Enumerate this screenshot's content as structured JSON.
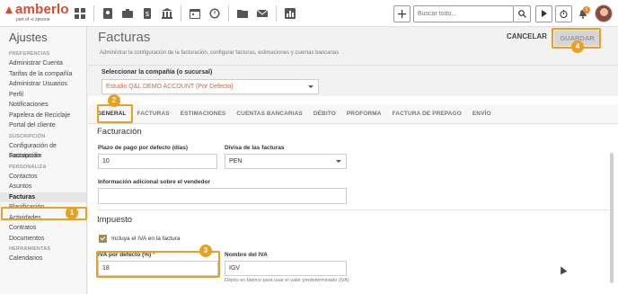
{
  "brand": {
    "name": "amberlo",
    "tagline": "part of ⊲ zpnone",
    "color": "#d84a2e"
  },
  "topbar": {
    "icons": [
      "dashboard-icon",
      "contacts-icon",
      "briefcase-icon",
      "invoice-icon",
      "bank-icon",
      "calendar-icon",
      "history-icon",
      "folder-icon",
      "mail-icon",
      "reports-icon"
    ],
    "search_placeholder": "Buscar todo...",
    "notification_count": "1"
  },
  "sidebar": {
    "title": "Ajustes",
    "sections": [
      {
        "heading": "PREFERENCIAS",
        "items": [
          "Administrar Cuenta",
          "Tarifas de la compañía",
          "Administrar Usuarios",
          "Perfil",
          "Notificaciones",
          "Papelera de Reciclaje",
          "Portal del cliente"
        ]
      },
      {
        "heading": "SUSCRIPCIÓN",
        "items": [
          "Configuración de suscripción",
          "Facturación"
        ]
      },
      {
        "heading": "PERSONALIZA",
        "items": [
          "Contactos",
          "Asuntos",
          "Facturas",
          "Planificación",
          "Actividades",
          "Contratos",
          "Documentos"
        ]
      },
      {
        "heading": "HERRAMIENTAS",
        "items": [
          "Calendarios"
        ]
      }
    ],
    "active_item": "Facturas"
  },
  "header": {
    "title": "Facturas",
    "description": "Administrar la configuración de la facturación, configurar facturas, estimaciones y cuentas bancarias",
    "cancel_label": "CANCELAR",
    "save_label": "GUARDAR"
  },
  "company": {
    "label": "Seleccionar la compañía (o sucursal)",
    "value": "Estudio Q&L DEMO ACCOUNT (Por Defecto)"
  },
  "tabs": [
    "GENERAL",
    "FACTURAS",
    "ESTIMACIONES",
    "CUENTAS BANCARIAS",
    "DÉBITO",
    "PROFORMA",
    "FACTURA DE PREPAGO",
    "ENVÍO"
  ],
  "billing": {
    "section_title": "Facturación",
    "payment_term_label": "Plazo de pago por defecto (días)",
    "payment_term_value": "10",
    "currency_label": "Divisa de las facturas",
    "currency_value": "PEN",
    "seller_info_label": "Información adicional sobre el vendedor",
    "seller_info_value": ""
  },
  "tax": {
    "section_title": "Impuesto",
    "include_vat_label": "Incluya el IVA en la factura",
    "include_vat_checked": true,
    "vat_rate_label": "IVA por defecto (%)",
    "vat_rate_required_mark": "*",
    "vat_rate_value": "18",
    "vat_name_label": "Nombre del IVA",
    "vat_name_value": "IGV",
    "vat_name_hint": "Déjelo en blanco para usar el valor predeterminado (IVA)"
  },
  "annotations": {
    "marker_1": "1",
    "marker_2": "2",
    "marker_3": "3",
    "marker_4": "4",
    "highlight_color": "#e8a020"
  }
}
